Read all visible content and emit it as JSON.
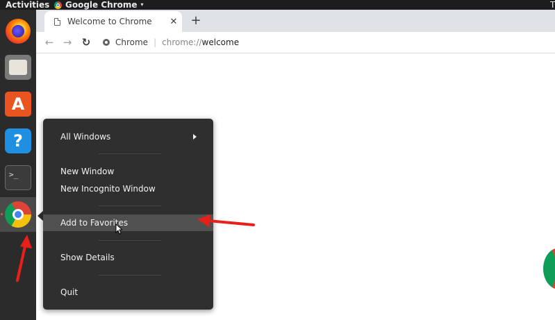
{
  "topbar": {
    "activities": "Activities",
    "app_name": "Google Chrome",
    "app_caret": "▾",
    "right_fragment": "T"
  },
  "dock": {
    "items": [
      {
        "name": "firefox",
        "icon": "firefox-icon"
      },
      {
        "name": "files",
        "icon": "files-icon"
      },
      {
        "name": "ubuntu-software",
        "icon": "software-icon"
      },
      {
        "name": "help",
        "icon": "help-icon",
        "glyph": "?"
      },
      {
        "name": "terminal",
        "icon": "terminal-icon",
        "glyph": ">_"
      },
      {
        "name": "chrome",
        "icon": "chrome-icon",
        "active": true
      }
    ]
  },
  "browser": {
    "tab_title": "Welcome to Chrome",
    "tab_close": "✕",
    "new_tab": "+",
    "back": "←",
    "forward": "→",
    "reload": "↻",
    "site_name": "Chrome",
    "separator": "|",
    "url_scheme": "chrome://",
    "url_host": "welcome"
  },
  "context_menu": {
    "items": [
      {
        "label": "All Windows",
        "has_submenu": true
      },
      {
        "label": "New Window"
      },
      {
        "label": "New Incognito Window"
      },
      {
        "label": "Add to Favorites",
        "highlighted": true
      },
      {
        "label": "Show Details"
      },
      {
        "label": "Quit"
      }
    ]
  },
  "annotations": {
    "color": "#e8201a"
  }
}
